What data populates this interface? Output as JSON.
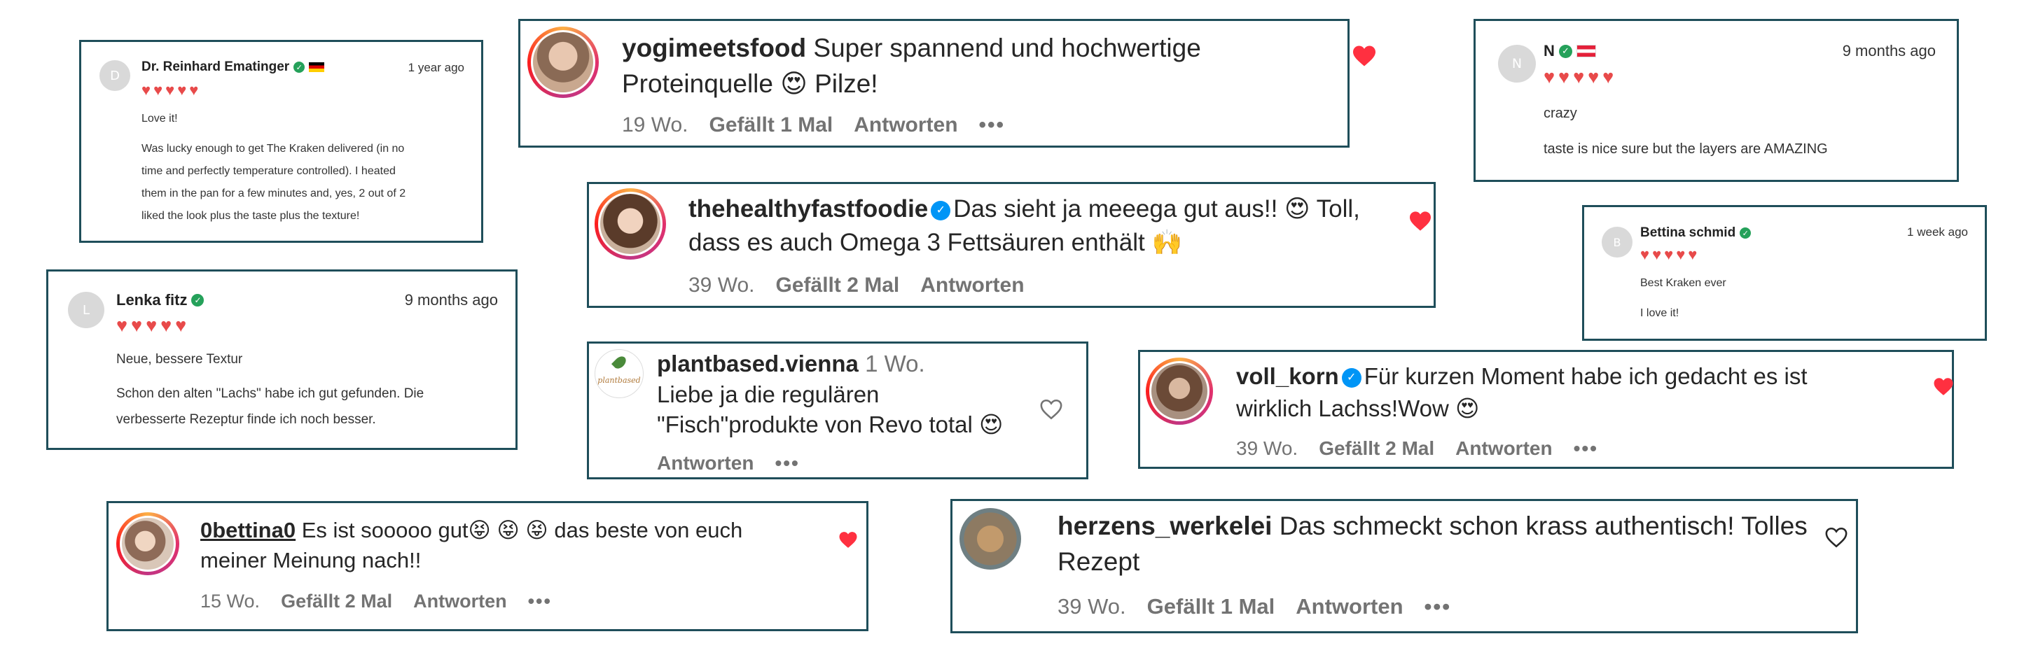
{
  "reviews": {
    "reinhard": {
      "initial": "D",
      "name": "Dr. Reinhard Ematinger",
      "date": "1 year ago",
      "title": "Love it!",
      "body": [
        "Was lucky enough to get The Kraken delivered (in no",
        "time and perfectly temperature controlled). I heated",
        "them in the pan for a few minutes and, yes, 2 out of 2",
        "liked the look plus the taste plus the texture!"
      ],
      "stars": 5
    },
    "lenka": {
      "initial": "L",
      "name": "Lenka fitz",
      "date": "9 months ago",
      "title": "Neue, bessere Textur",
      "body": [
        "Schon den alten \"Lachs\" habe ich gut gefunden. Die",
        "verbesserte Rezeptur finde ich noch besser."
      ],
      "stars": 5
    },
    "n": {
      "initial": "N",
      "name": "N",
      "date": "9 months ago",
      "title": "crazy",
      "body": [
        "taste is nice sure but the layers are AMAZING"
      ],
      "stars": 5
    },
    "bettina": {
      "initial": "B",
      "name": "Bettina schmid",
      "date": "1 week ago",
      "title": "Best Kraken ever",
      "body": [
        "I love it!"
      ],
      "stars": 5
    }
  },
  "comments": {
    "yogi": {
      "user": "yogimeetsfood",
      "lines": [
        "Super spannend und hochwertige",
        "Proteinquelle 😍 Pilze!"
      ],
      "age": "19 Wo.",
      "likes": "Gefällt 1 Mal",
      "reply": "Antworten",
      "more": "•••",
      "liked": true
    },
    "healthy": {
      "user": "thehealthyfastfoodie",
      "lines": [
        "Das sieht ja meeega gut aus!! 😍 Toll,",
        "dass es auch Omega 3 Fettsäuren enthält 🙌"
      ],
      "age": "39 Wo.",
      "likes": "Gefällt 2 Mal",
      "reply": "Antworten",
      "liked": true
    },
    "plantbased": {
      "user": "plantbased.vienna",
      "age_inline": "1 Wo.",
      "avatar_text": "plantbased",
      "lines": [
        "Liebe ja die regulären",
        "\"Fisch\"produkte von Revo total 😍"
      ],
      "reply": "Antworten",
      "more": "•••",
      "liked": false
    },
    "vollkorn": {
      "user": "voll_korn",
      "lines": [
        "Für kurzen Moment habe ich gedacht es ist",
        "wirklich Lachss!Wow 😍"
      ],
      "age": "39 Wo.",
      "likes": "Gefällt 2 Mal",
      "reply": "Antworten",
      "more": "•••",
      "liked": true
    },
    "bettina0": {
      "user": "0bettina0",
      "lines": [
        "Es ist sooooo gut😝 😝 😝  das beste von euch",
        "meiner Meinung nach!!"
      ],
      "age": "15 Wo.",
      "likes": "Gefällt 2 Mal",
      "reply": "Antworten",
      "more": "•••",
      "liked": true
    },
    "herzens": {
      "user": "herzens_werkelei",
      "lines": [
        "Das schmeckt schon krass authentisch! Tolles",
        "Rezept"
      ],
      "age": "39 Wo.",
      "likes": "Gefällt 1 Mal",
      "reply": "Antworten",
      "more": "•••",
      "liked": false
    }
  },
  "colors": {
    "border": "#1f4e5a",
    "heart_red": "#ff3040",
    "star_red": "#e84a4a",
    "verified_green": "#25a15a",
    "verified_blue": "#0095f6"
  }
}
